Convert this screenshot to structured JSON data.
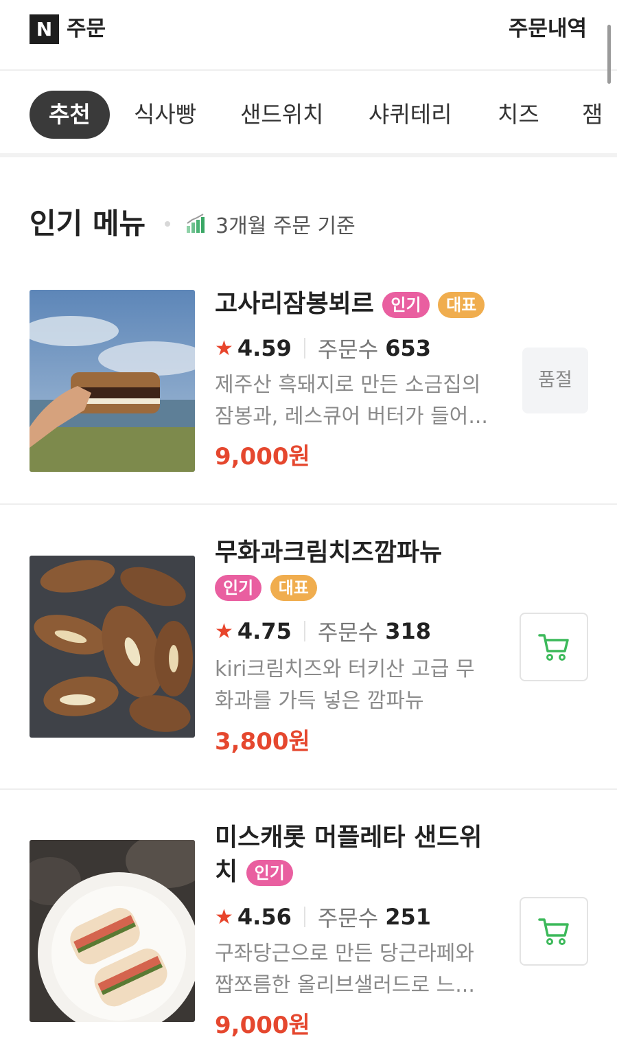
{
  "header": {
    "logo_letter": "N",
    "title": "주문",
    "order_history": "주문내역"
  },
  "tabs": [
    {
      "label": "추천",
      "active": true
    },
    {
      "label": "식사빵"
    },
    {
      "label": "샌드위치"
    },
    {
      "label": "샤퀴테리"
    },
    {
      "label": "치즈"
    },
    {
      "label": "잼"
    }
  ],
  "section": {
    "title": "인기 메뉴",
    "basis": "3개월 주문 기준"
  },
  "items": [
    {
      "name": "고사리잠봉뵈르",
      "badges": [
        "인기",
        "대표"
      ],
      "rating": "4.59",
      "order_label": "주문수",
      "order_count": "653",
      "desc_line1": "제주산 흑돼지로 만든 소금집의",
      "desc_line2": "잠봉과, 레스큐어 버터가 들어...",
      "price": "9,000원",
      "action": "품절"
    },
    {
      "name": "무화과크림치즈깜파뉴",
      "badges": [
        "인기",
        "대표"
      ],
      "rating": "4.75",
      "order_label": "주문수",
      "order_count": "318",
      "desc_line1": "kiri크림치즈와 터키산 고급 무",
      "desc_line2": "화과를 가득 넣은 깜파뉴",
      "price": "3,800원",
      "action": "cart-icon"
    },
    {
      "name_line1": "미스캐롯 머플레타 샌드위",
      "name_line2": "치",
      "badges": [
        "인기"
      ],
      "rating": "4.56",
      "order_label": "주문수",
      "order_count": "251",
      "desc_line1": "구좌당근으로 만든 당근라페와",
      "desc_line2": "짭쪼름한 올리브샐러드로 느...",
      "price": "9,000원",
      "action": "cart-icon"
    }
  ],
  "colors": {
    "price": "#e5472e",
    "star": "#e8452c",
    "badge_popular": "#e95fa0",
    "badge_signature": "#f0ad4e",
    "cart": "#3cb95a",
    "active_tab": "#3a3a3a"
  }
}
